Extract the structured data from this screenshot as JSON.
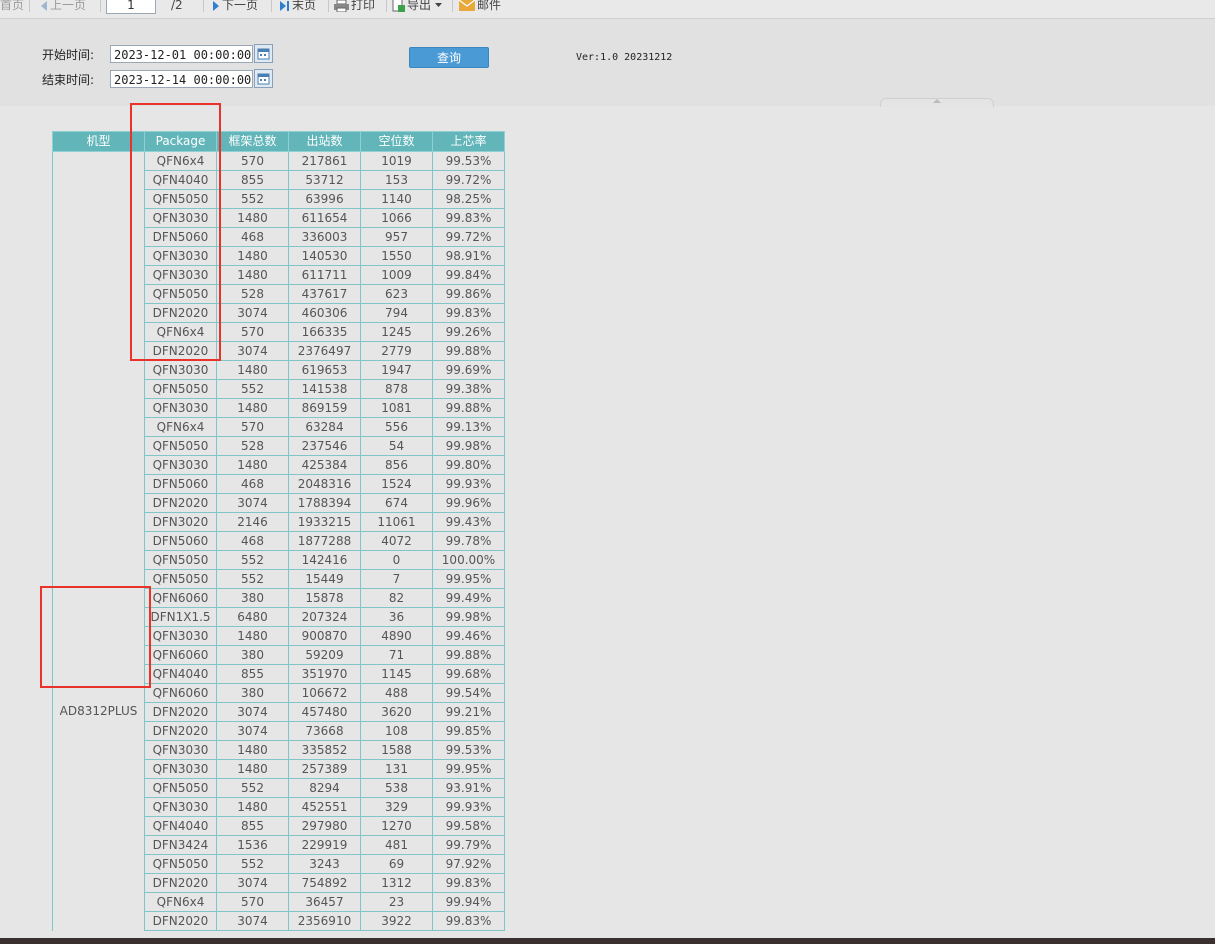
{
  "toolbar": {
    "first": "首页",
    "prev": "上一页",
    "page": "1",
    "total": "/2",
    "next": "下一页",
    "last": "末页",
    "print": "打印",
    "export": "导出",
    "mail": "邮件"
  },
  "query": {
    "start_label": "开始时间:",
    "start_value": "2023-12-01 00:00:00",
    "end_label": "结束时间:",
    "end_value": "2023-12-14 00:00:00",
    "button": "查询",
    "version": "Ver:1.0 20231212"
  },
  "table": {
    "headers": [
      "机型",
      "Package",
      "框架总数",
      "出站数",
      "空位数",
      "上芯率"
    ],
    "model": "AD8312PLUS",
    "rows": [
      [
        "QFN6x4",
        "570",
        "217861",
        "1019",
        "99.53%"
      ],
      [
        "QFN4040",
        "855",
        "53712",
        "153",
        "99.72%"
      ],
      [
        "QFN5050",
        "552",
        "63996",
        "1140",
        "98.25%"
      ],
      [
        "QFN3030",
        "1480",
        "611654",
        "1066",
        "99.83%"
      ],
      [
        "DFN5060",
        "468",
        "336003",
        "957",
        "99.72%"
      ],
      [
        "QFN3030",
        "1480",
        "140530",
        "1550",
        "98.91%"
      ],
      [
        "QFN3030",
        "1480",
        "611711",
        "1009",
        "99.84%"
      ],
      [
        "QFN5050",
        "528",
        "437617",
        "623",
        "99.86%"
      ],
      [
        "DFN2020",
        "3074",
        "460306",
        "794",
        "99.83%"
      ],
      [
        "QFN6x4",
        "570",
        "166335",
        "1245",
        "99.26%"
      ],
      [
        "DFN2020",
        "3074",
        "2376497",
        "2779",
        "99.88%"
      ],
      [
        "QFN3030",
        "1480",
        "619653",
        "1947",
        "99.69%"
      ],
      [
        "QFN5050",
        "552",
        "141538",
        "878",
        "99.38%"
      ],
      [
        "QFN3030",
        "1480",
        "869159",
        "1081",
        "99.88%"
      ],
      [
        "QFN6x4",
        "570",
        "63284",
        "556",
        "99.13%"
      ],
      [
        "QFN5050",
        "528",
        "237546",
        "54",
        "99.98%"
      ],
      [
        "QFN3030",
        "1480",
        "425384",
        "856",
        "99.80%"
      ],
      [
        "DFN5060",
        "468",
        "2048316",
        "1524",
        "99.93%"
      ],
      [
        "DFN2020",
        "3074",
        "1788394",
        "674",
        "99.96%"
      ],
      [
        "DFN3020",
        "2146",
        "1933215",
        "11061",
        "99.43%"
      ],
      [
        "DFN5060",
        "468",
        "1877288",
        "4072",
        "99.78%"
      ],
      [
        "QFN5050",
        "552",
        "142416",
        "0",
        "100.00%"
      ],
      [
        "QFN5050",
        "552",
        "15449",
        "7",
        "99.95%"
      ],
      [
        "QFN6060",
        "380",
        "15878",
        "82",
        "99.49%"
      ],
      [
        "DFN1X1.5",
        "6480",
        "207324",
        "36",
        "99.98%"
      ],
      [
        "QFN3030",
        "1480",
        "900870",
        "4890",
        "99.46%"
      ],
      [
        "QFN6060",
        "380",
        "59209",
        "71",
        "99.88%"
      ],
      [
        "QFN4040",
        "855",
        "351970",
        "1145",
        "99.68%"
      ],
      [
        "QFN6060",
        "380",
        "106672",
        "488",
        "99.54%"
      ],
      [
        "DFN2020",
        "3074",
        "457480",
        "3620",
        "99.21%"
      ],
      [
        "DFN2020",
        "3074",
        "73668",
        "108",
        "99.85%"
      ],
      [
        "QFN3030",
        "1480",
        "335852",
        "1588",
        "99.53%"
      ],
      [
        "QFN3030",
        "1480",
        "257389",
        "131",
        "99.95%"
      ],
      [
        "QFN5050",
        "552",
        "8294",
        "538",
        "93.91%"
      ],
      [
        "QFN3030",
        "1480",
        "452551",
        "329",
        "99.93%"
      ],
      [
        "QFN4040",
        "855",
        "297980",
        "1270",
        "99.58%"
      ],
      [
        "DFN3424",
        "1536",
        "229919",
        "481",
        "99.79%"
      ],
      [
        "QFN5050",
        "552",
        "3243",
        "69",
        "97.92%"
      ],
      [
        "DFN2020",
        "3074",
        "754892",
        "1312",
        "99.83%"
      ],
      [
        "QFN6x4",
        "570",
        "36457",
        "23",
        "99.94%"
      ],
      [
        "DFN2020",
        "3074",
        "2356910",
        "3922",
        "99.83%"
      ]
    ]
  },
  "colors": {
    "header_bg": "#62b5b9",
    "grid_border": "#7fc6c9",
    "query_button": "#4a9ad6",
    "annotation": "#e8322a"
  }
}
